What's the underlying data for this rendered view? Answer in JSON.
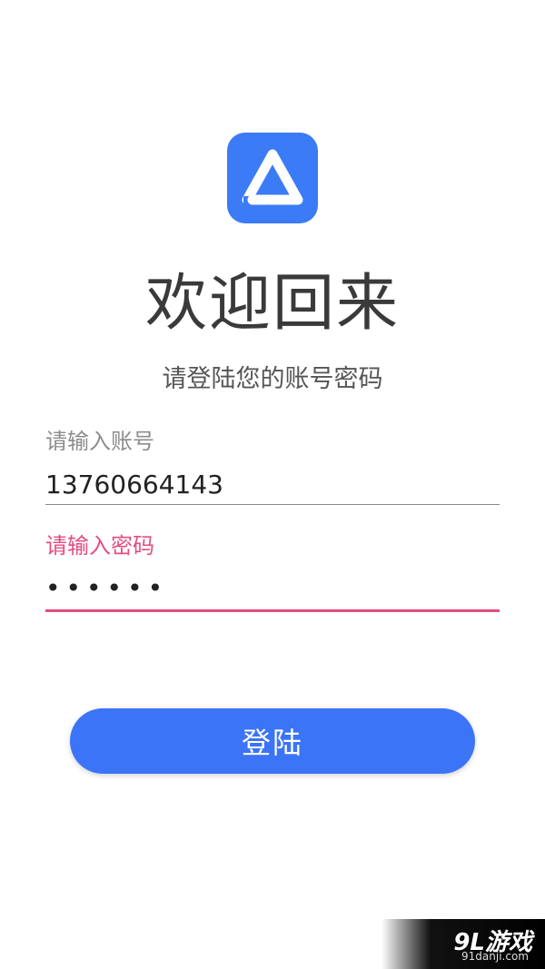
{
  "logo": {
    "icon": "triangle-a-icon",
    "color": "#3b7bf6"
  },
  "heading": {
    "title": "欢迎回来",
    "subtitle": "请登陆您的账号密码"
  },
  "form": {
    "account": {
      "label": "请输入账号",
      "value": "13760664143"
    },
    "password": {
      "label": "请输入密码",
      "value": "••••••",
      "accent": "#e44c82"
    }
  },
  "login_button": {
    "label": "登陆",
    "color": "#3b74f7"
  },
  "watermark": {
    "brand": "9L游戏",
    "site": "91danji.com"
  }
}
